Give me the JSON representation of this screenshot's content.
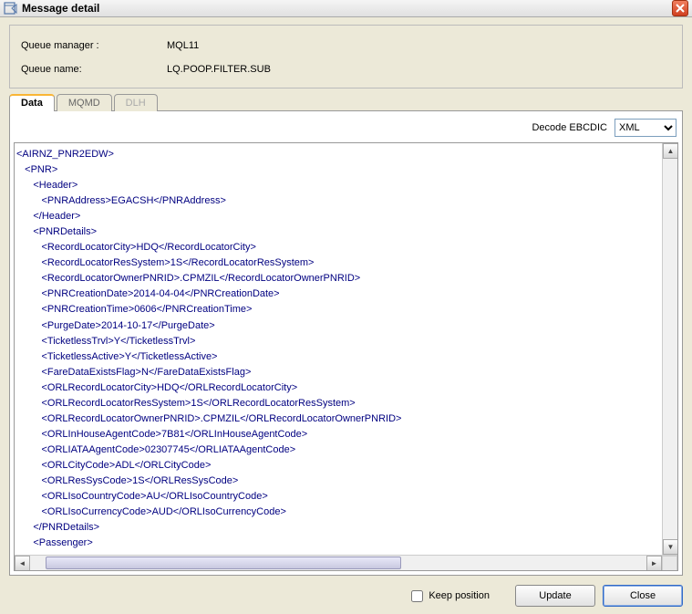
{
  "window": {
    "title": "Message detail"
  },
  "info": {
    "queueManagerLabel": "Queue manager :",
    "queueManagerValue": "MQL11",
    "queueNameLabel": "Queue name:",
    "queueNameValue": "LQ.POOP.FILTER.SUB"
  },
  "tabs": {
    "data": "Data",
    "mqmd": "MQMD",
    "dlh": "DLH"
  },
  "decode": {
    "label": "Decode EBCDIC",
    "selected": "XML",
    "options": [
      "XML"
    ]
  },
  "xml": {
    "lines": [
      "<AIRNZ_PNR2EDW>",
      "   <PNR>",
      "      <Header>",
      "         <PNRAddress>EGACSH</PNRAddress>",
      "      </Header>",
      "      <PNRDetails>",
      "         <RecordLocatorCity>HDQ</RecordLocatorCity>",
      "         <RecordLocatorResSystem>1S</RecordLocatorResSystem>",
      "         <RecordLocatorOwnerPNRID>.CPMZIL</RecordLocatorOwnerPNRID>",
      "         <PNRCreationDate>2014-04-04</PNRCreationDate>",
      "         <PNRCreationTime>0606</PNRCreationTime>",
      "         <PurgeDate>2014-10-17</PurgeDate>",
      "         <TicketlessTrvl>Y</TicketlessTrvl>",
      "         <TicketlessActive>Y</TicketlessActive>",
      "         <FareDataExistsFlag>N</FareDataExistsFlag>",
      "         <ORLRecordLocatorCity>HDQ</ORLRecordLocatorCity>",
      "         <ORLRecordLocatorResSystem>1S</ORLRecordLocatorResSystem>",
      "         <ORLRecordLocatorOwnerPNRID>.CPMZIL</ORLRecordLocatorOwnerPNRID>",
      "         <ORLInHouseAgentCode>7B81</ORLInHouseAgentCode>",
      "         <ORLIATAAgentCode>02307745</ORLIATAAgentCode>",
      "         <ORLCityCode>ADL</ORLCityCode>",
      "         <ORLResSysCode>1S</ORLResSysCode>",
      "         <ORLIsoCountryCode>AU</ORLIsoCountryCode>",
      "         <ORLIsoCurrencyCode>AUD</ORLIsoCurrencyCode>",
      "      </PNRDetails>",
      "      <Passenger>"
    ]
  },
  "footer": {
    "keepPosition": "Keep position",
    "update": "Update",
    "close": "Close"
  }
}
